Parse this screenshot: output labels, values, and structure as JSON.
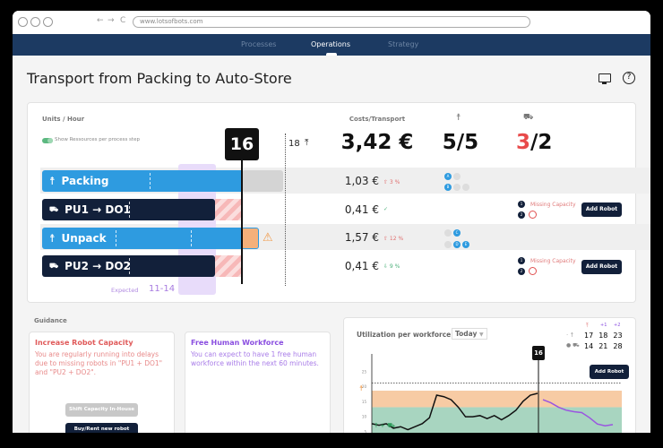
{
  "browser": {
    "url": "www.lotsofbots.com",
    "back": "←",
    "forward": "→",
    "reload": "C"
  },
  "nav": {
    "tabs": [
      {
        "label": "Processes"
      },
      {
        "label": "Operations",
        "active": true
      },
      {
        "label": "Strategy"
      }
    ]
  },
  "page": {
    "title": "Transport from Packing to Auto-Store",
    "icons": [
      "monitor-icon",
      "help-icon"
    ],
    "help_glyph": "?"
  },
  "process": {
    "units_label": "Units / Hour",
    "toggle_label": "Show Ressources per process step",
    "toggle_on": true,
    "current": "16",
    "max": "18",
    "max_icon": "⤒",
    "expected_label": "Expected",
    "expected_range": "11-14",
    "costs_header": "Costs/Transport",
    "total_cost": "3,42 €",
    "humans": "5/5",
    "robots_used": "3",
    "robots_rest": "/2",
    "warning_icon": "⚠",
    "rows": [
      {
        "label": "Packing",
        "type": "human",
        "icon": "👤",
        "cost": "1,03 €",
        "change": "⇧ 3 %",
        "change_color": "#e07070",
        "workers": [
          [
            "A",
            ""
          ],
          [
            "B",
            "",
            ""
          ]
        ]
      },
      {
        "label": "PU1 → DO1",
        "type": "robot",
        "cost": "0,41 €",
        "change": "✓",
        "change_color": "#4caf7a",
        "missing": "Missing Capacity",
        "robots": [
          "1",
          "2"
        ],
        "add": "Add Robot"
      },
      {
        "label": "Unpack",
        "type": "human",
        "cost": "1,57 €",
        "change": "⇧ 12 %",
        "change_color": "#e07070",
        "workers": [
          [
            "",
            "C"
          ],
          [
            "",
            "D",
            "E"
          ]
        ]
      },
      {
        "label": "PU2 → DO2",
        "type": "robot",
        "cost": "0,41 €",
        "change": "⇩ 9 %",
        "change_color": "#4caf7a",
        "missing": "Missing Capacity",
        "robots": [
          "1",
          "2"
        ],
        "add": "Add Robot"
      }
    ],
    "colors": {
      "human": "#2e9be0",
      "robot": "#12203a",
      "over": "#f4b07a",
      "missing": "#e05050",
      "expected": "#c8a8f0"
    }
  },
  "guidance": {
    "label": "Guidance",
    "cards": [
      {
        "title": "Increase Robot Capacity",
        "text": "You are regularly running into delays due to missing robots in \"PU1 + DO1\" and \"PU2 + DO2\".",
        "buttons": [
          "Shift Capacity In-House",
          "Buy/Rent new robot"
        ]
      },
      {
        "title": "Free Human Workforce",
        "text": "You can expect to have 1 free human workforce within the next 60 minutes."
      }
    ]
  },
  "utilization": {
    "title": "Utilization per workforce",
    "period": "Today",
    "forecast": {
      "headers": [
        "",
        "+1",
        "+2"
      ],
      "rows": [
        {
          "icon": "human",
          "values": [
            "17",
            "18",
            "23"
          ]
        },
        {
          "icon": "robot",
          "values": [
            "14",
            "21",
            "28"
          ]
        }
      ]
    },
    "marker": "16",
    "add_robot": "Add Robot",
    "zone_human_label": "👤",
    "zone_both_label": "👤 + 🤖",
    "chart_data": {
      "type": "line",
      "yticks": [
        5,
        10,
        15,
        20,
        25
      ],
      "ylim": [
        0,
        27
      ],
      "threshold": 21,
      "bands": [
        {
          "from": 0,
          "to": 13,
          "color": "#a8d5c0"
        },
        {
          "from": 13,
          "to": 18.5,
          "color": "#f7cba4"
        }
      ],
      "actual": [
        7.5,
        7,
        7.5,
        6,
        6.5,
        5.5,
        6.5,
        7.5,
        9.5,
        17,
        16.5,
        15.5,
        13,
        9.8,
        9.8,
        10.2,
        9.2,
        10.2,
        8.8,
        10.2,
        12,
        15,
        17,
        17.6
      ],
      "forecast": [
        15.5,
        14.5,
        13,
        12,
        11.5,
        11.2,
        9.5,
        7.4,
        6.8,
        7.2
      ],
      "robot_gaps": [
        [
          10,
          14
        ],
        [
          23,
          27
        ]
      ]
    }
  }
}
